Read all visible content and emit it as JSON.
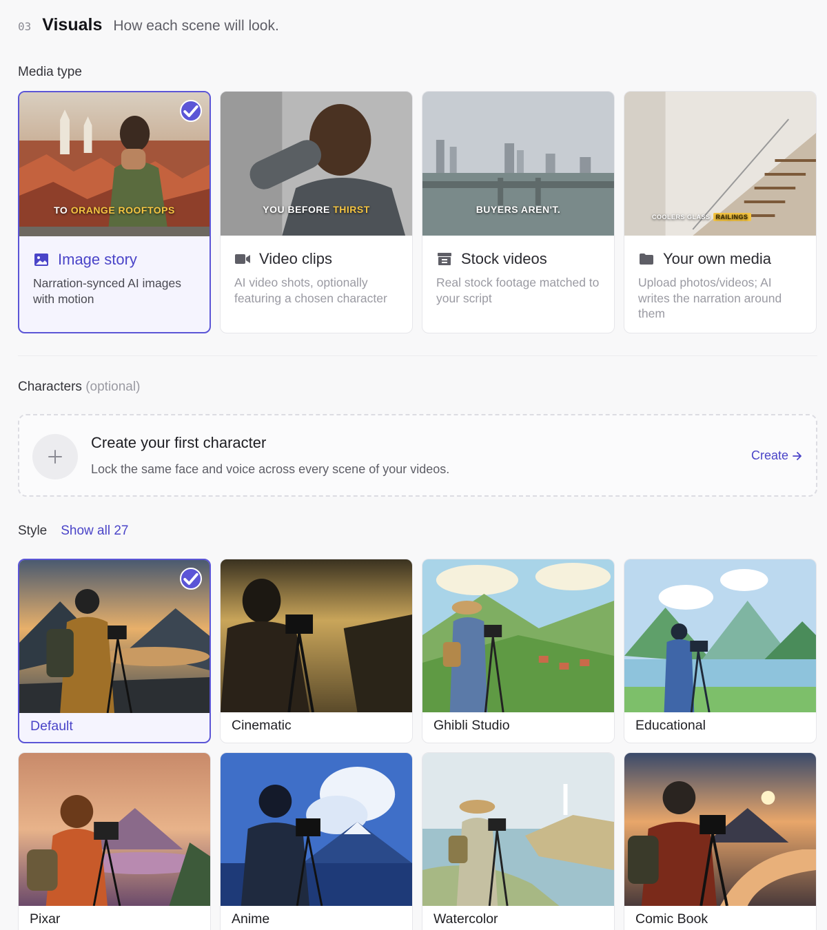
{
  "header": {
    "step": "03",
    "title": "Visuals",
    "subtitle": "How each scene will look."
  },
  "media": {
    "label": "Media type",
    "cards": [
      {
        "title": "Image story",
        "desc": "Narration-synced AI images with motion",
        "icon": "image-icon",
        "selected": true,
        "caption_pre": "TO ",
        "caption_hl": "ORANGE ROOFTOPS"
      },
      {
        "title": "Video clips",
        "desc": "AI video shots, optionally featuring a chosen character",
        "icon": "video-camera-icon",
        "selected": false,
        "caption_pre": "YOU BEFORE ",
        "caption_hl": "THIRST"
      },
      {
        "title": "Stock videos",
        "desc": "Real stock footage matched to your script",
        "icon": "archive-icon",
        "selected": false,
        "caption_pre": "BUYERS AREN'T.",
        "caption_hl": ""
      },
      {
        "title": "Your own media",
        "desc": "Upload photos/videos; AI writes the narration around them",
        "icon": "folder-icon",
        "selected": false,
        "caption_pre": "COOLERS GLASS",
        "caption_hl": "RAILINGS"
      }
    ]
  },
  "characters": {
    "label": "Characters",
    "optional": "(optional)",
    "create_title": "Create your first character",
    "create_desc": "Lock the same face and voice across every scene of your videos.",
    "create_link": "Create"
  },
  "style": {
    "label": "Style",
    "show_all": "Show all 27",
    "items": [
      {
        "name": "Default",
        "selected": true
      },
      {
        "name": "Cinematic"
      },
      {
        "name": "Ghibli Studio"
      },
      {
        "name": "Educational"
      },
      {
        "name": "Pixar"
      },
      {
        "name": "Anime"
      },
      {
        "name": "Watercolor"
      },
      {
        "name": "Comic Book"
      }
    ]
  },
  "colors": {
    "accent": "#5b55d6",
    "accent_text": "#4a44c8",
    "selected_bg": "#f5f4fe"
  }
}
